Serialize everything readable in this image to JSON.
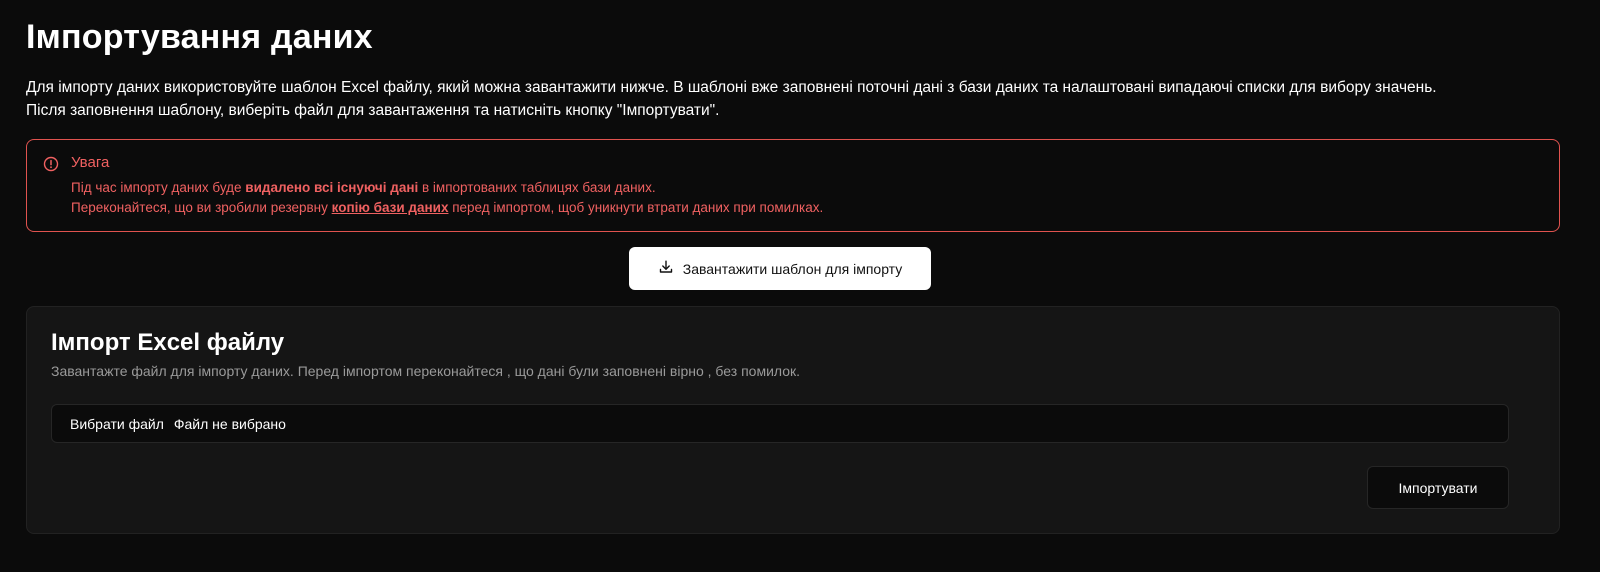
{
  "page": {
    "title": "Імпортування даних",
    "intro_line1": "Для імпорту даних використовуйте шаблон Excel файлу, який можна завантажити нижче. В шаблоні вже заповнені поточні дані з бази даних та налаштовані випадаючі списки для вибору значень.",
    "intro_line2": "Після заповнення шаблону, виберіть файл для завантаження та натисніть кнопку \"Імпортувати\"."
  },
  "alert": {
    "title": "Увага",
    "line1_before": "Під час імпорту даних буде ",
    "line1_bold": "видалено всі існуючі дані",
    "line1_after": " в імпортованих таблицях бази даних.",
    "line2_before": "Переконайтеся, що ви зробили резервну ",
    "line2_link": "копію бази даних",
    "line2_after": " перед імпортом, щоб уникнути втрати даних при помилках.",
    "icon": "alert-circle-icon",
    "color": "#f06161"
  },
  "download": {
    "label": "Завантажити шаблон для імпорту",
    "icon": "download-icon"
  },
  "import_card": {
    "title": "Імпорт Excel файлу",
    "description": "Завантажте файл для імпорту даних. Перед імпортом переконайтеся , що дані були заповнені вірно , без помилок.",
    "file_button_label": "Вибрати файл",
    "file_status": "Файл не вибрано",
    "import_label": "Імпортувати"
  }
}
